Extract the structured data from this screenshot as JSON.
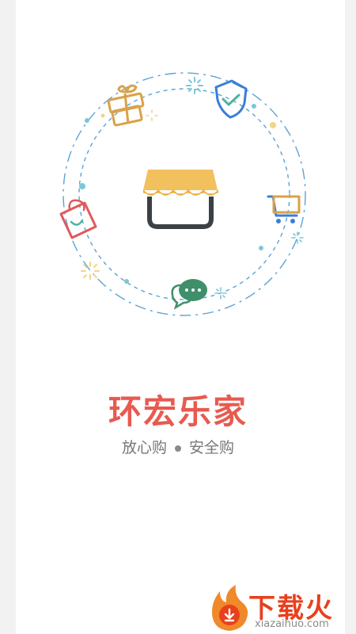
{
  "brand": {
    "title": "环宏乐家",
    "slogan_left": "放心购",
    "slogan_right": "安全购"
  },
  "watermark": {
    "text": "下载火",
    "subtext": "xiazaihuo.com"
  },
  "colors": {
    "title": "#e85a4f",
    "awning": "#f2c05c",
    "circle": "#5ba3d6",
    "gift": "#d9a24a",
    "shield": "#3b7dd8",
    "cart": "#3b7dd8",
    "chat": "#3f8f6b",
    "bag": "#e05a5a"
  },
  "icons": [
    "gift-icon",
    "shield-check-icon",
    "cart-icon",
    "chat-bubble-icon",
    "shopping-bag-icon",
    "store-icon"
  ]
}
